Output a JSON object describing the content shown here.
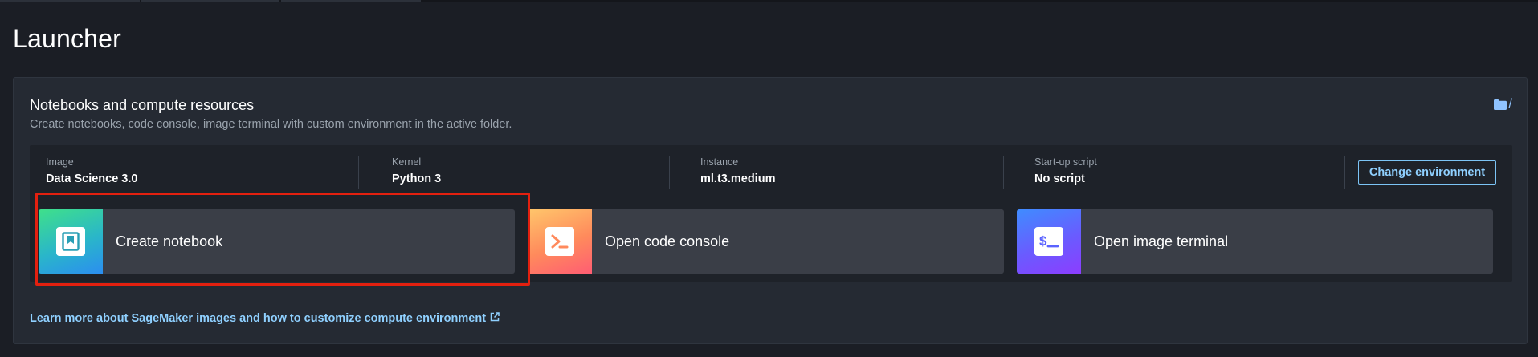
{
  "page": {
    "title": "Launcher"
  },
  "section": {
    "title": "Notebooks and compute resources",
    "subtitle": "Create notebooks, code console, image terminal with custom environment in the active folder.",
    "folder_path": "/",
    "folder_icon": "folder-icon"
  },
  "environment": {
    "fields": [
      {
        "label": "Image",
        "value": "Data Science 3.0"
      },
      {
        "label": "Kernel",
        "value": "Python 3"
      },
      {
        "label": "Instance",
        "value": "ml.t3.medium"
      },
      {
        "label": "Start-up script",
        "value": "No script"
      }
    ],
    "change_button": "Change environment"
  },
  "actions": [
    {
      "label": "Create notebook",
      "icon": "notebook-icon",
      "highlighted": true
    },
    {
      "label": "Open code console",
      "icon": "code-console-icon",
      "highlighted": false
    },
    {
      "label": "Open image terminal",
      "icon": "terminal-icon",
      "highlighted": false
    }
  ],
  "footer": {
    "learn_more": "Learn more about SageMaker images and how to customize compute environment",
    "external_icon": "external-link-icon"
  },
  "colors": {
    "background": "#1b1e25",
    "panel": "#252a33",
    "card": "#3a3e47",
    "link": "#8fd0ff",
    "highlight": "#e3200f"
  }
}
